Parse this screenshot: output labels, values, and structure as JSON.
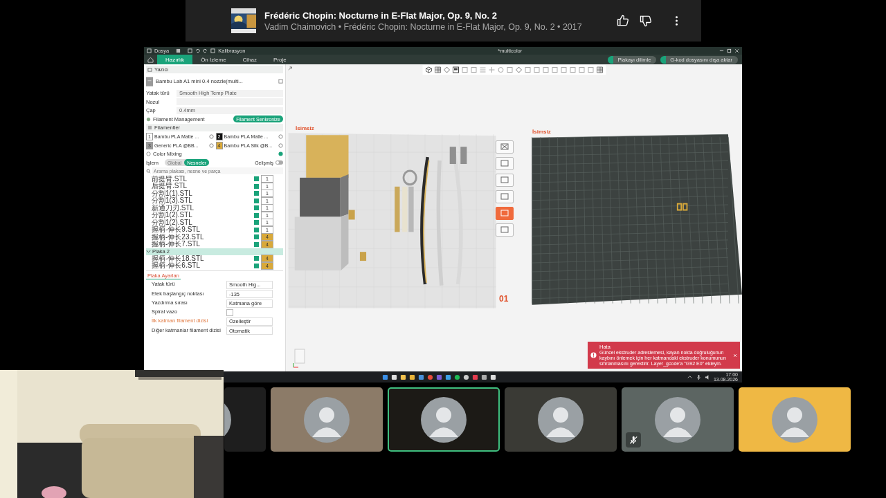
{
  "now_playing": {
    "title": "Frédéric Chopin: Nocturne in E-Flat Major, Op. 9, No. 2",
    "subtitle": "Vadim Chaimovich • Frédéric Chopin: Nocturne in E-Flat Major, Op. 9, No. 2 • 2017"
  },
  "app": {
    "menu": "Dosya",
    "calibration": "Kalibrasyon",
    "title": "*multicolor",
    "tabs": [
      {
        "label": "Hazırlık",
        "selected": true
      },
      {
        "label": "Ön İzleme",
        "selected": false
      },
      {
        "label": "Cihaz",
        "selected": false
      },
      {
        "label": "Proje",
        "selected": false
      }
    ],
    "actions": [
      "Plakayı dilimle",
      "G-kod dosyasını dışa aktar"
    ]
  },
  "printer": {
    "heading": "Yazıcı",
    "name": "Bambu Lab A1 mini 0.4 nozzle(multi...",
    "fields": [
      {
        "label": "Yatak türü",
        "value": "Smooth High Temp Plate"
      },
      {
        "label": "Nozul"
      },
      {
        "label": "Çap",
        "value": "0.4mm"
      }
    ]
  },
  "filament_management": {
    "label": "Filament Management",
    "button": "Filament Senkronize"
  },
  "filaments": {
    "heading": "Filamentler",
    "items": [
      {
        "number": "1",
        "name": "Bambu PLA Matte ...",
        "color": "#ffffff"
      },
      {
        "number": "2",
        "name": "Bambu PLA Matte ...",
        "color": "#111111"
      },
      {
        "number": "3",
        "name": "Generic PLA @BB...",
        "color": "#9a9a9a"
      },
      {
        "number": "4",
        "name": "Bambu PLA Silk @B...",
        "color": "#d9a93a"
      }
    ]
  },
  "color_mixing": {
    "label": "Color Mixing"
  },
  "process": {
    "label": "İşlem",
    "modes": [
      {
        "label": "Global",
        "selected": false
      },
      {
        "label": "Nesneler",
        "selected": true
      }
    ],
    "advanced": {
      "label": "Gelişmiş",
      "on": false
    }
  },
  "object_search": {
    "placeholder": "Arama plakası, nesne ve parça"
  },
  "objects": [
    {
      "name": "前提臂.STL",
      "checked": true,
      "filament": "1",
      "color": "#ffffff"
    },
    {
      "name": "后提臂.STL",
      "checked": true,
      "filament": "1",
      "color": "#ffffff"
    },
    {
      "name": "分割1(1).STL",
      "checked": true,
      "filament": "1",
      "color": "#ffffff"
    },
    {
      "name": "分割1(3).STL",
      "checked": true,
      "filament": "1",
      "color": "#ffffff"
    },
    {
      "name": "新通刀刃.STL",
      "checked": true,
      "filament": "1",
      "color": "#ffffff"
    },
    {
      "name": "分割1(2).STL",
      "checked": true,
      "filament": "1",
      "color": "#ffffff"
    },
    {
      "name": "分割1(2).STL",
      "checked": true,
      "filament": "1",
      "color": "#ffffff"
    },
    {
      "name": "握柄-伸长9.STL",
      "checked": true,
      "filament": "1",
      "color": "#ffffff"
    },
    {
      "name": "握柄-伸长23.STL",
      "checked": true,
      "filament": "4",
      "color": "#d9a93a"
    },
    {
      "name": "握柄-伸长7.STL",
      "checked": true,
      "filament": "4",
      "color": "#d9a93a"
    }
  ],
  "plates": [
    {
      "label": "Plaka 2",
      "expanded": true,
      "selected": true,
      "children": [
        {
          "name": "握柄-伸长18.STL",
          "checked": true,
          "filament": "4",
          "color": "#d9a93a"
        },
        {
          "name": "握柄-伸长6.STL",
          "checked": true,
          "filament": "4",
          "color": "#d9a93a"
        }
      ]
    }
  ],
  "plate_settings": {
    "tab": "Plaka Ayarları",
    "rows": [
      {
        "kind": "select",
        "label": "Yatak türü",
        "value": "Smooth Hig...",
        "highlighted": false
      },
      {
        "kind": "select",
        "label": "Etek başlangıç noktası",
        "value": "-135",
        "highlighted": false
      },
      {
        "kind": "select",
        "label": "Yazdırma sırası",
        "value": "Katmana göre",
        "highlighted": false
      },
      {
        "kind": "checkbox",
        "label": "Spiral vazo",
        "checked": false,
        "highlighted": false
      },
      {
        "kind": "select",
        "label": "İlk katman filament dizisi",
        "value": "Özelleştir",
        "highlighted": true
      },
      {
        "kind": "select",
        "label": "Diğer katmanlar filament dizisi",
        "value": "Otomatik",
        "highlighted": false
      }
    ]
  },
  "scene": {
    "plates": [
      {
        "label": "İsimsiz",
        "number": "01"
      },
      {
        "label": "İsimsiz"
      }
    ],
    "plate_tools": [
      {
        "selected": false
      },
      {
        "selected": false
      },
      {
        "selected": false
      },
      {
        "selected": false
      },
      {
        "selected": true
      },
      {
        "selected": false
      }
    ]
  },
  "error": {
    "title": "Hata",
    "message": "Güncel ekstruder adreslemesi, kayan nokta doğruluğunun kaybını önlemek için her katmandaki ekstruder konumunun sıfırlanmasını gerektirir. Layer_gcode'a \"G92 E0\" ekleyin."
  },
  "taskbar": {
    "time": "17:00",
    "date": "13.08.2026"
  },
  "participants": [
    {
      "color": "#1e1e1e",
      "selected": false,
      "muted": false
    },
    {
      "color": "#8c7b68",
      "selected": false,
      "muted": false
    },
    {
      "color": "#1c1a16",
      "selected": true,
      "muted": false
    },
    {
      "color": "#3a3a35",
      "selected": false,
      "muted": false
    },
    {
      "color": "#5c6562",
      "selected": false,
      "muted": true
    },
    {
      "color": "#efb844",
      "selected": false,
      "muted": false
    }
  ]
}
